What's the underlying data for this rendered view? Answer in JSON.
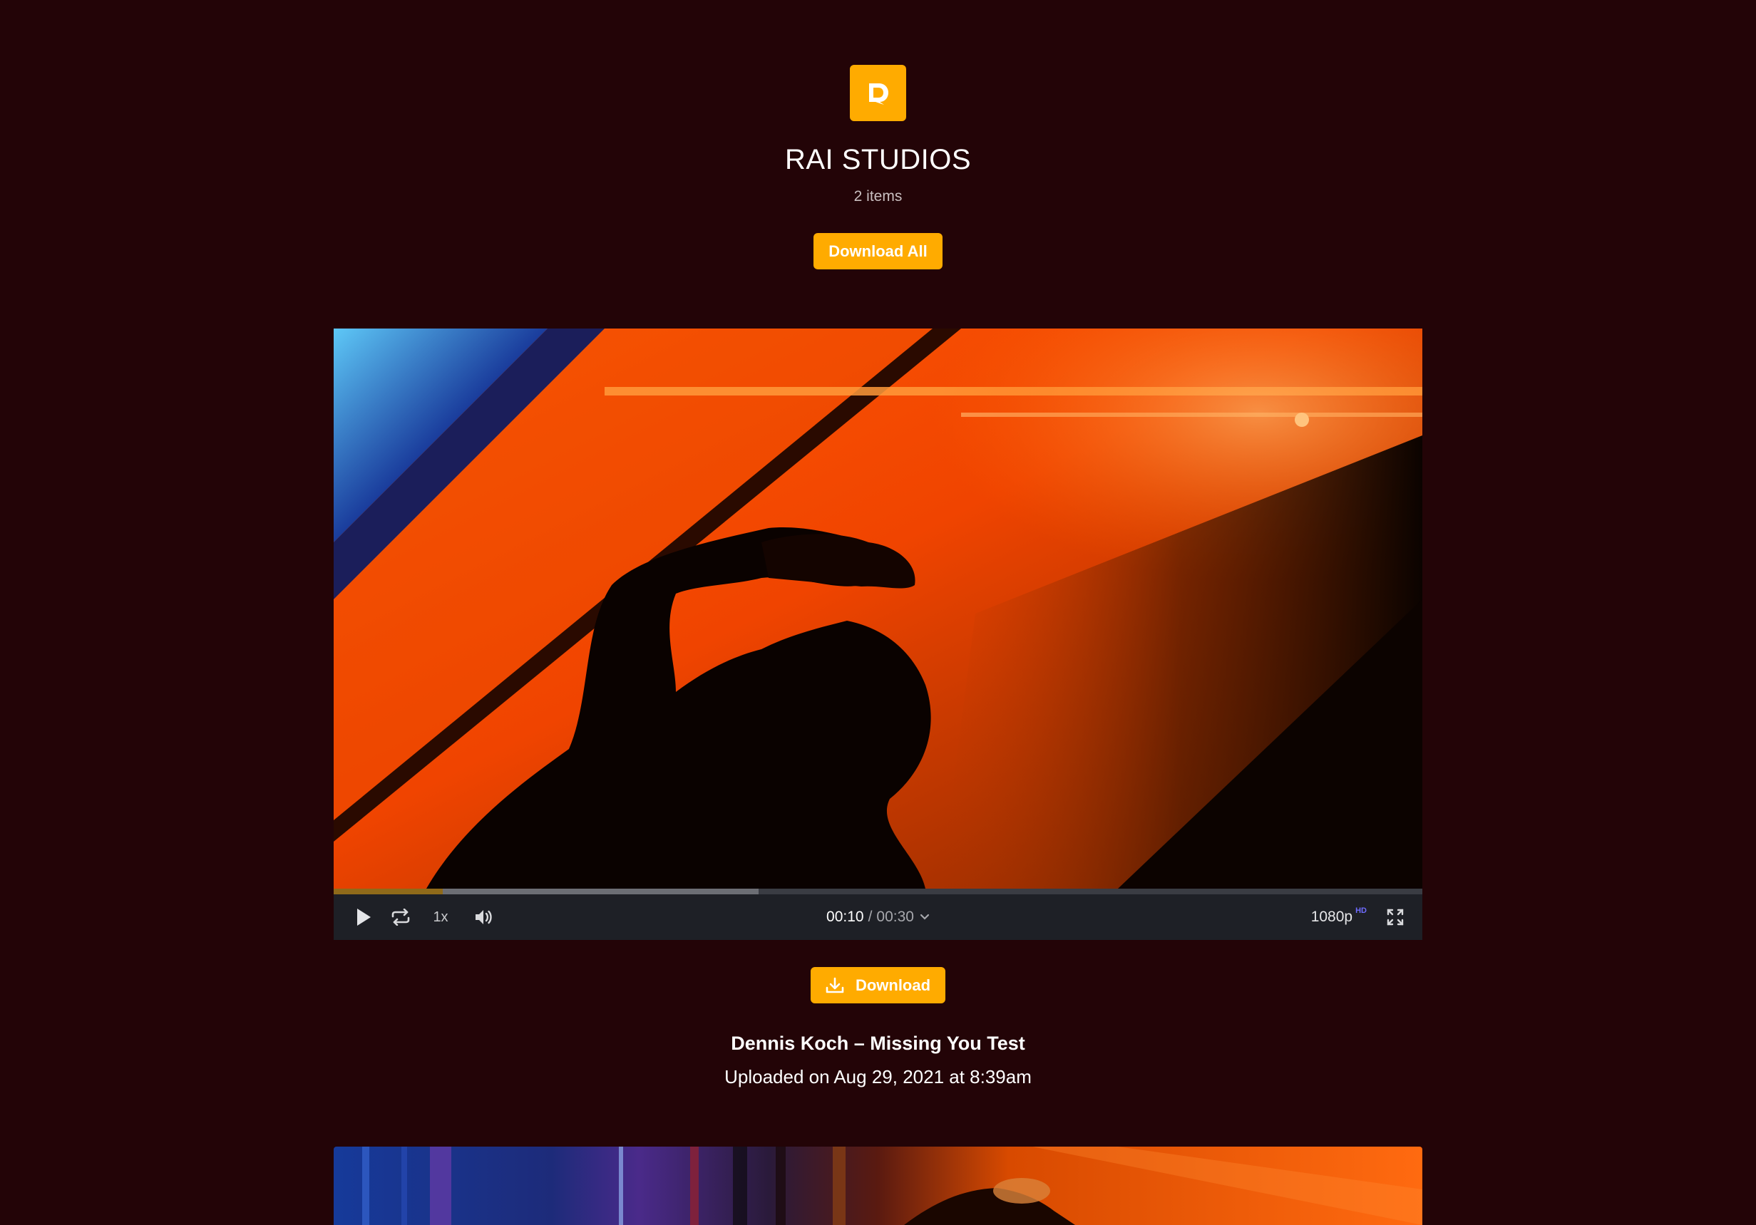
{
  "header": {
    "logo_icon": "chat-bubble-d-icon",
    "studio_name": "RAI STUDIOS",
    "item_count": "2 items",
    "download_all_label": "Download All"
  },
  "colors": {
    "background": "#230407",
    "accent": "#ffab00",
    "player_bar": "#1e2026",
    "hd_badge": "#6f6cff"
  },
  "player": {
    "controls": {
      "play_icon": "play-icon",
      "loop_icon": "loop-icon",
      "speed": "1x",
      "volume_icon": "volume-icon",
      "current_time": "00:10",
      "separator": "/",
      "total_time": "00:30",
      "chevron_icon": "chevron-down-icon",
      "quality": "1080p",
      "quality_badge": "HD",
      "fullscreen_icon": "fullscreen-icon"
    },
    "progress": {
      "played_fraction": 0.1,
      "buffered_fraction": 0.39
    }
  },
  "items": [
    {
      "download_label": "Download",
      "download_icon": "download-icon",
      "title": "Dennis Koch – Missing You Test",
      "uploaded": "Uploaded on Aug 29, 2021 at 8:39am"
    }
  ]
}
